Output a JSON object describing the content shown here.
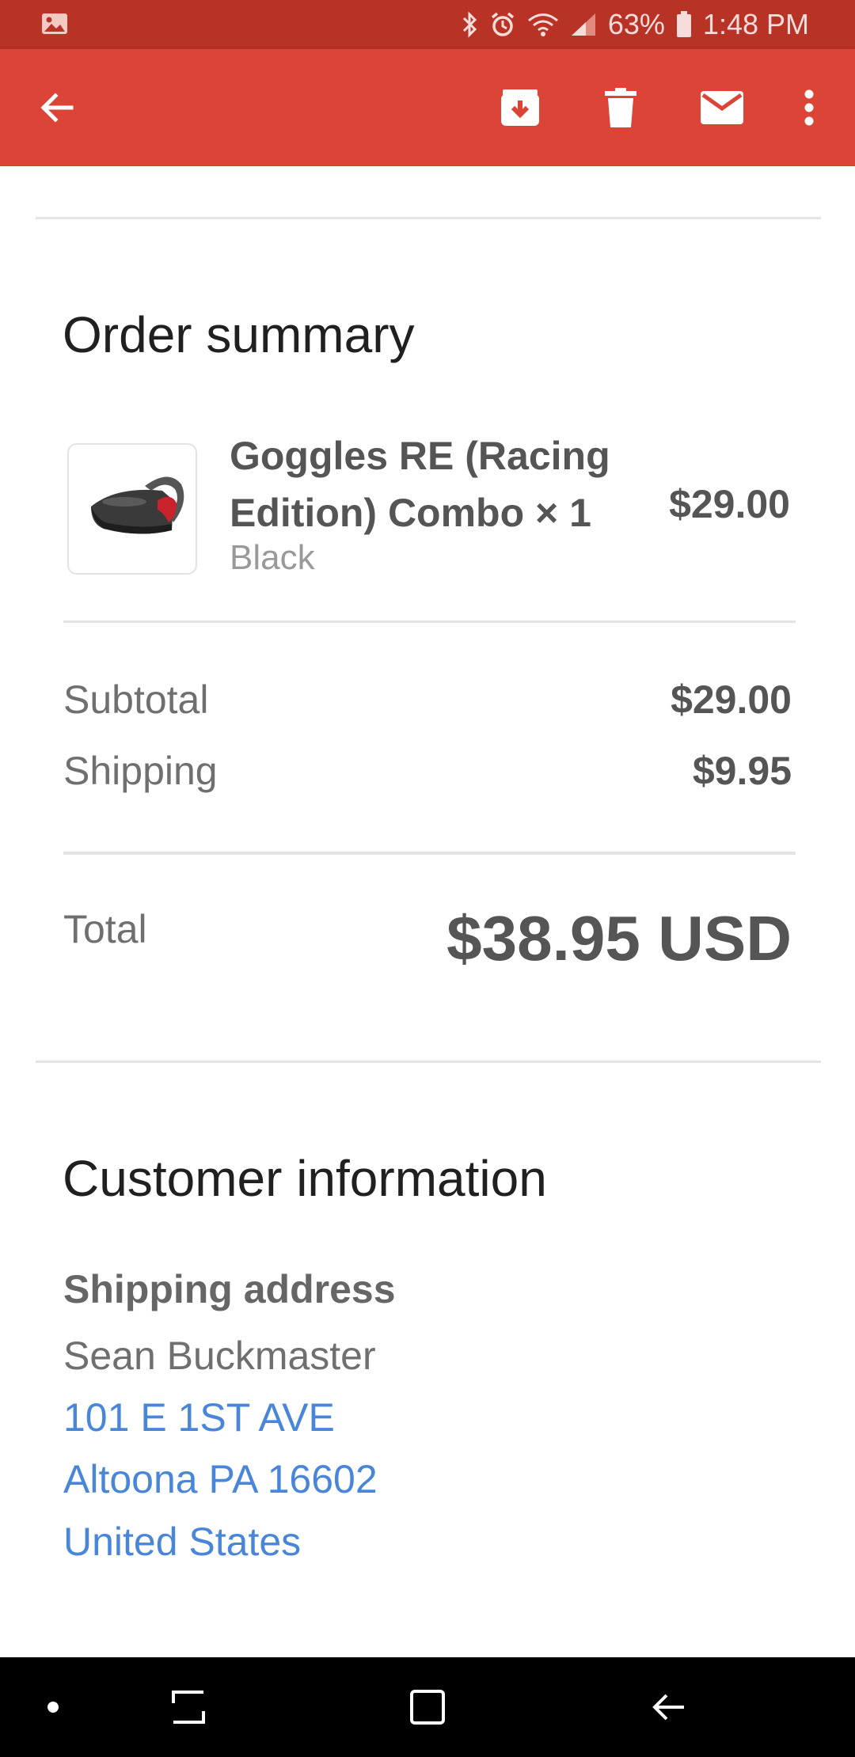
{
  "status_bar": {
    "battery": "63%",
    "time": "1:48 PM",
    "icons": [
      "image-icon",
      "bluetooth-icon",
      "alarm-icon",
      "wifi-icon",
      "signal-icon",
      "battery-icon"
    ]
  },
  "app_bar": {
    "icons": [
      "back-arrow-icon",
      "archive-icon",
      "delete-icon",
      "mail-icon",
      "more-vert-icon"
    ],
    "color": "#db4437"
  },
  "order_summary": {
    "title": "Order summary",
    "item": {
      "name": "Goggles RE (Racing Edition) Combo × 1",
      "variant": "Black",
      "price": "$29.00"
    },
    "subtotal_label": "Subtotal",
    "subtotal_value": "$29.00",
    "shipping_label": "Shipping",
    "shipping_value": "$9.95",
    "total_label": "Total",
    "total_value": "$38.95 USD"
  },
  "customer_info": {
    "title": "Customer information",
    "shipping_address_label": "Shipping address",
    "name": "Sean Buckmaster",
    "address_line1": "101 E 1ST AVE",
    "address_line2": "Altoona PA 16602",
    "country": "United States",
    "link_color": "#4a86d8"
  },
  "nav_bar": {
    "icons": [
      "dot-icon",
      "recents-icon",
      "home-icon",
      "back-icon"
    ]
  }
}
